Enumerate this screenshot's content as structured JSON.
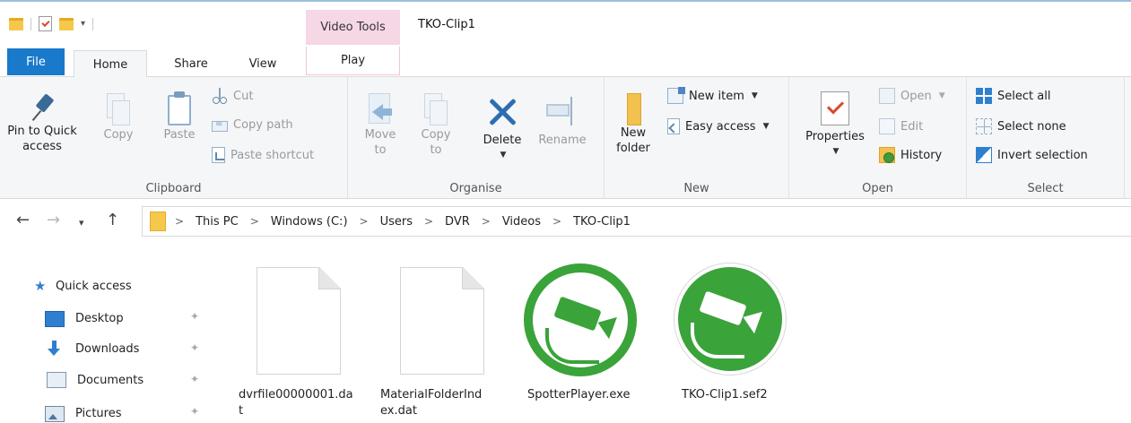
{
  "window": {
    "title": "TKO-Clip1",
    "context_tab_header": "Video Tools"
  },
  "tabs": {
    "file": "File",
    "home": "Home",
    "share": "Share",
    "view": "View",
    "play": "Play"
  },
  "ribbon": {
    "clipboard": {
      "label": "Clipboard",
      "pin": "Pin to Quick\naccess",
      "copy": "Copy",
      "paste": "Paste",
      "cut": "Cut",
      "copy_path": "Copy path",
      "paste_shortcut": "Paste shortcut"
    },
    "organise": {
      "label": "Organise",
      "move_to": "Move\nto",
      "copy_to": "Copy\nto",
      "delete": "Delete",
      "rename": "Rename"
    },
    "new": {
      "label": "New",
      "new_folder": "New\nfolder",
      "new_item": "New item",
      "easy_access": "Easy access"
    },
    "open": {
      "label": "Open",
      "properties": "Properties",
      "open": "Open",
      "edit": "Edit",
      "history": "History"
    },
    "select": {
      "label": "Select",
      "select_all": "Select all",
      "select_none": "Select none",
      "invert_selection": "Invert selection"
    }
  },
  "address": {
    "crumbs": [
      "This PC",
      "Windows (C:)",
      "Users",
      "DVR",
      "Videos",
      "TKO-Clip1"
    ],
    "separator": ">"
  },
  "navpane": {
    "quick_access": "Quick access",
    "items": [
      "Desktop",
      "Downloads",
      "Documents",
      "Pictures"
    ]
  },
  "files": [
    {
      "name": "dvrfile00000001.dat",
      "icon": "blank-file-icon"
    },
    {
      "name": "MaterialFolderIndex.dat",
      "icon": "blank-file-icon"
    },
    {
      "name": "SpotterPlayer.exe",
      "icon": "spotter-camera-icon"
    },
    {
      "name": "TKO-Clip1.sef2",
      "icon": "spotter-clip-icon"
    }
  ],
  "colors": {
    "file_tab": "#1979ca",
    "context_tab": "#f6d7e6",
    "spotter_green": "#3aa33a"
  }
}
